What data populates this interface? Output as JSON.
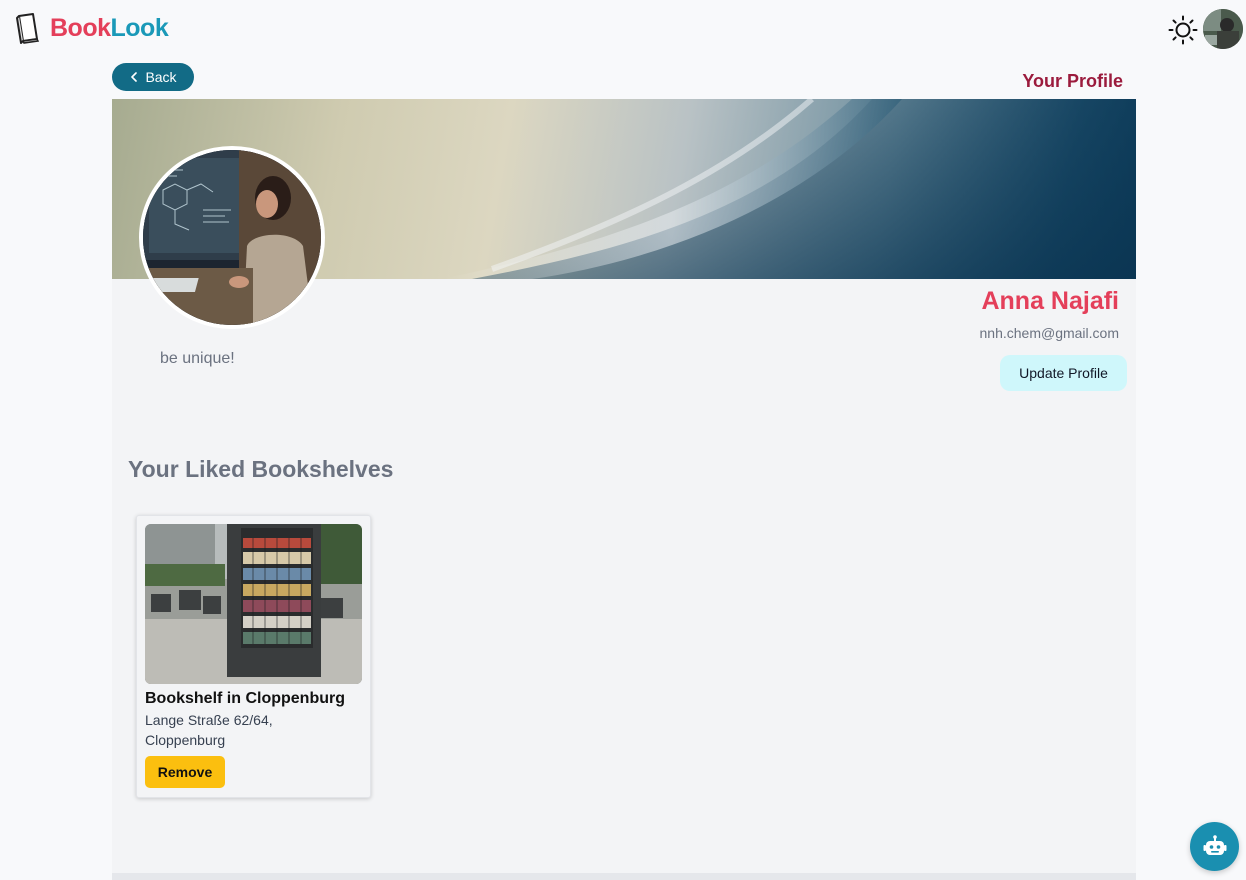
{
  "header": {
    "logo_part1": "Book",
    "logo_part2": "Look",
    "logo_icon": "book-icon",
    "theme_icon": "sun-icon",
    "avatar_icon": "user-avatar"
  },
  "nav": {
    "back_label": "Back",
    "back_icon": "chevron-left-icon",
    "page_label": "Your Profile"
  },
  "profile": {
    "name": "Anna Najafi",
    "email": "nnh.chem@gmail.com",
    "bio": "be unique!",
    "update_label": "Update Profile"
  },
  "liked": {
    "title": "Your Liked Bookshelves",
    "items": [
      {
        "title": "Bookshelf in Cloppenburg",
        "address": "Lange Straße 62/64, Cloppenburg",
        "remove_label": "Remove"
      }
    ]
  },
  "chatbot": {
    "icon": "robot-icon"
  },
  "colors": {
    "brand_red": "#e43f5a",
    "brand_teal": "#1a99b8",
    "back_button": "#126b86",
    "profile_heading": "#9b1b3d",
    "update_button": "#cff7fb",
    "remove_button": "#fbbf0f",
    "chat_button": "#1a8fb0"
  }
}
